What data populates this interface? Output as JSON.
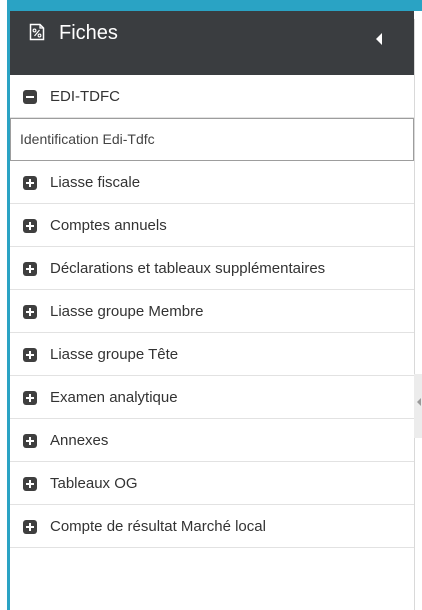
{
  "panel": {
    "title": "Fiches",
    "header_icon": "percent-document-icon",
    "collapse_icon": "caret-left-icon"
  },
  "tree": {
    "root": {
      "label": "EDI-TDFC",
      "expanded": true,
      "icon": "minus-square-icon"
    },
    "selected_child": {
      "label": "Identification Edi-Tdfc"
    },
    "items": [
      {
        "label": "Liasse fiscale",
        "icon": "plus-square-icon"
      },
      {
        "label": "Comptes annuels",
        "icon": "plus-square-icon"
      },
      {
        "label": "Déclarations et tableaux supplémentaires",
        "icon": "plus-square-icon"
      },
      {
        "label": "Liasse groupe Membre",
        "icon": "plus-square-icon"
      },
      {
        "label": "Liasse groupe Tête",
        "icon": "plus-square-icon"
      },
      {
        "label": "Examen analytique",
        "icon": "plus-square-icon"
      },
      {
        "label": "Annexes",
        "icon": "plus-square-icon"
      },
      {
        "label": "Tableaux OG",
        "icon": "plus-square-icon"
      },
      {
        "label": "Compte de résultat Marché local",
        "icon": "plus-square-icon"
      }
    ]
  },
  "colors": {
    "header_bg": "#3a3d40",
    "accent": "#2aa3c4",
    "row_border": "#e2e2e2"
  }
}
